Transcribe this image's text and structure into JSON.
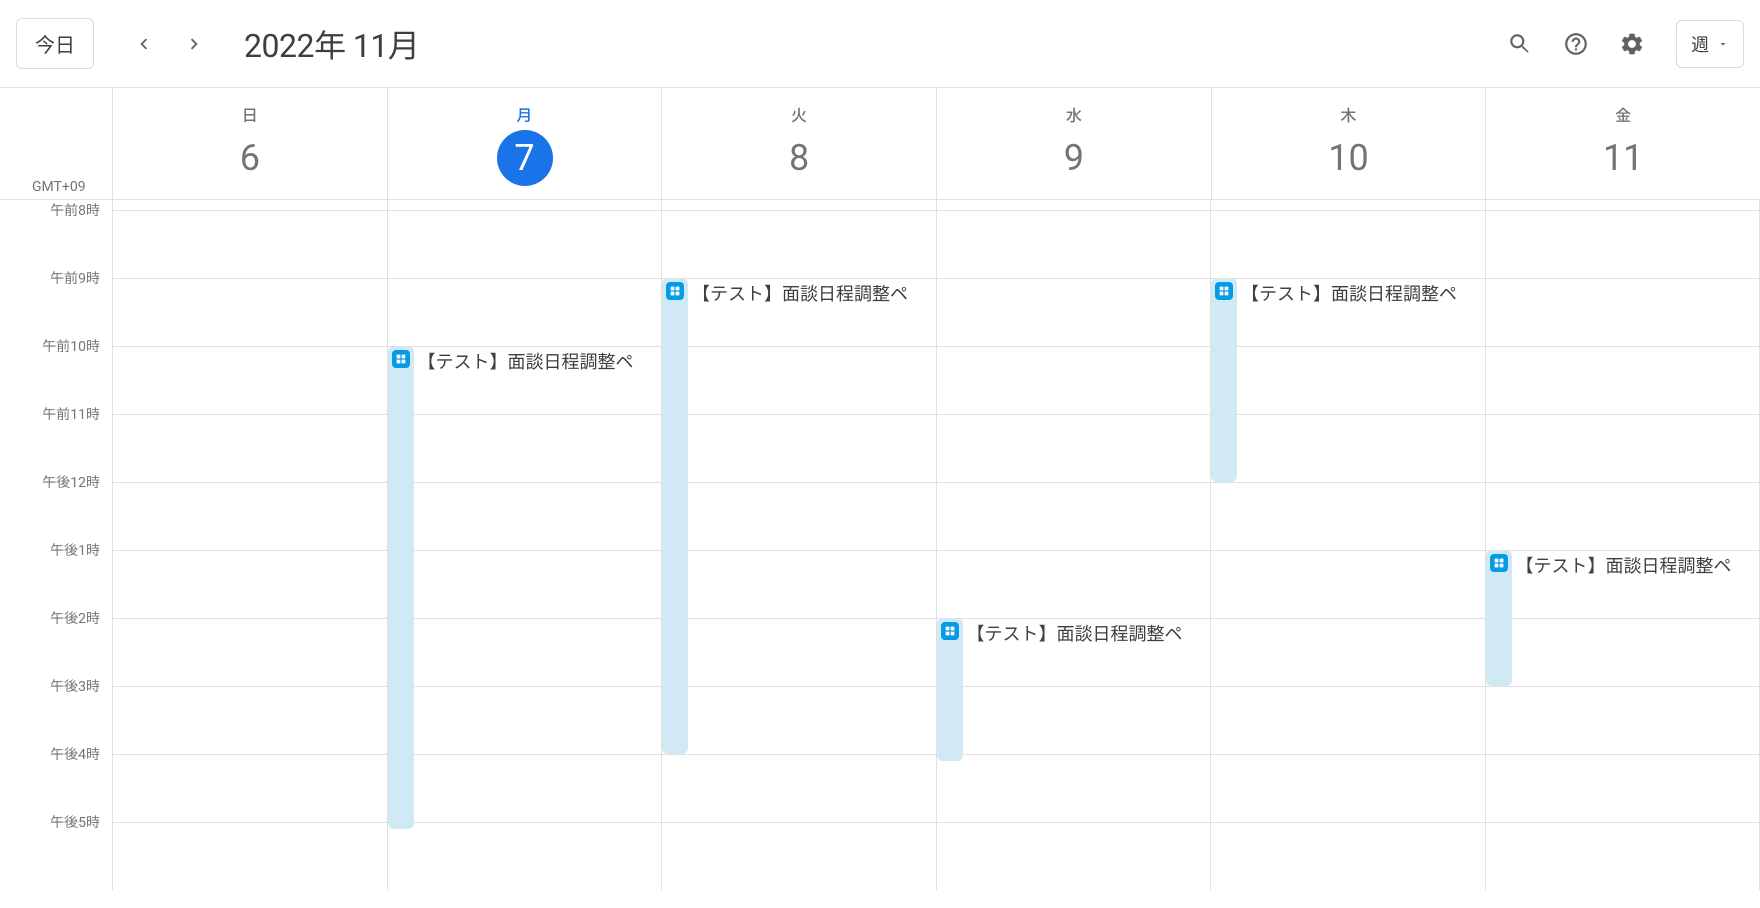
{
  "header": {
    "today_label": "今日",
    "date_title": "2022年 11月",
    "view_label": "週"
  },
  "timezone": "GMT+09",
  "days": [
    {
      "dow": "日",
      "num": "6",
      "is_today": false
    },
    {
      "dow": "月",
      "num": "7",
      "is_today": true
    },
    {
      "dow": "火",
      "num": "8",
      "is_today": false
    },
    {
      "dow": "水",
      "num": "9",
      "is_today": false
    },
    {
      "dow": "木",
      "num": "10",
      "is_today": false
    },
    {
      "dow": "金",
      "num": "11",
      "is_today": false
    }
  ],
  "hours": [
    {
      "label": "午前8時",
      "value": 8
    },
    {
      "label": "午前9時",
      "value": 9
    },
    {
      "label": "午前10時",
      "value": 10
    },
    {
      "label": "午前11時",
      "value": 11
    },
    {
      "label": "午後12時",
      "value": 12
    },
    {
      "label": "午後1時",
      "value": 13
    },
    {
      "label": "午後2時",
      "value": 14
    },
    {
      "label": "午後3時",
      "value": 15
    },
    {
      "label": "午後4時",
      "value": 16
    },
    {
      "label": "午後5時",
      "value": 17
    }
  ],
  "hour_height": 68,
  "start_hour": 7.85,
  "events": [
    {
      "day": 1,
      "start": 10.0,
      "end": 17.1,
      "title": "【テスト】面談日程調整ペ"
    },
    {
      "day": 2,
      "start": 9.0,
      "end": 16.0,
      "title": "【テスト】面談日程調整ペ"
    },
    {
      "day": 3,
      "start": 14.0,
      "end": 16.1,
      "title": "【テスト】面談日程調整ペ"
    },
    {
      "day": 4,
      "start": 9.0,
      "end": 12.0,
      "title": "【テスト】面談日程調整ペ"
    },
    {
      "day": 5,
      "start": 13.0,
      "end": 15.0,
      "title": "【テスト】面談日程調整ペ"
    }
  ]
}
